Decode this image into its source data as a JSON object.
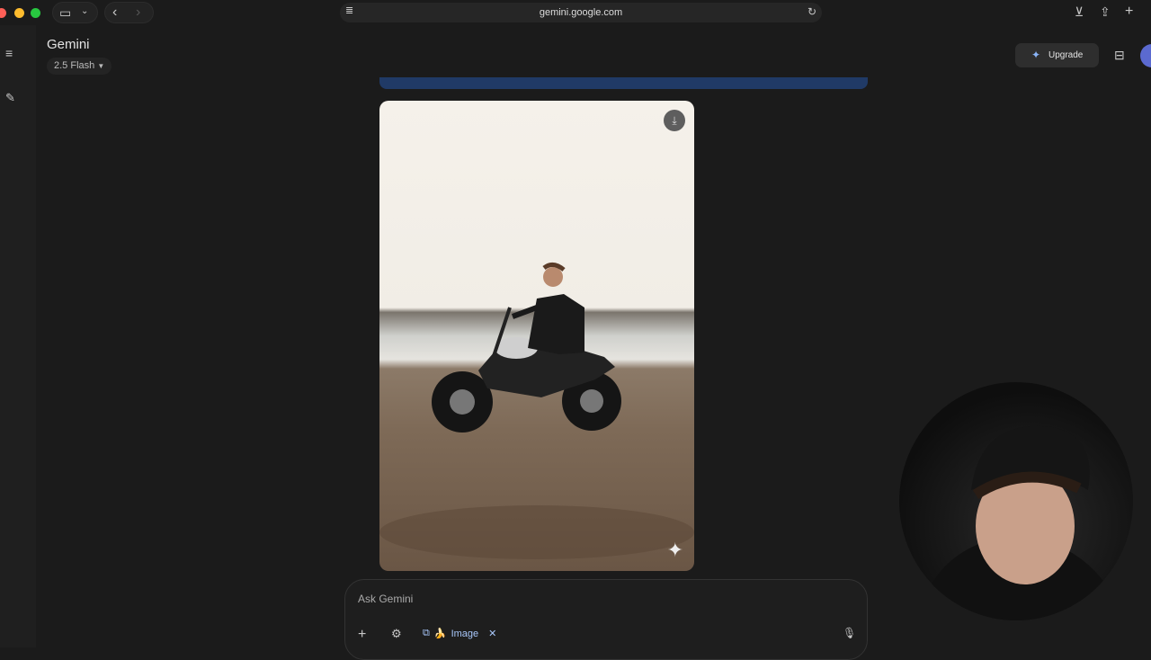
{
  "browser": {
    "url": "gemini.google.com"
  },
  "header": {
    "title": "Gemini",
    "model": "2.5 Flash",
    "upgrade_label": "Upgrade"
  },
  "composer": {
    "placeholder": "Ask Gemini",
    "tool_chip": "Image",
    "tool_emoji": "🍌"
  },
  "colors": {
    "accent_blue": "#203a66",
    "avatar": "#5b6ad0"
  }
}
